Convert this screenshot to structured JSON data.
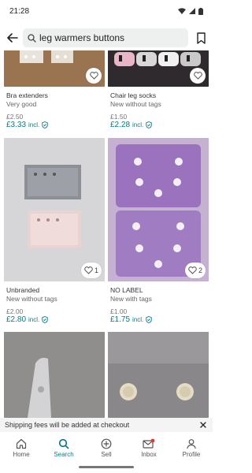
{
  "status": {
    "time": "21:28"
  },
  "search": {
    "query": "leg warmers buttons",
    "placeholder": "Search for items"
  },
  "products": [
    {
      "brand": "Bra extenders",
      "condition": "Very good",
      "price": "£2.50",
      "price_incl": "£3.33",
      "incl_label": "incl.",
      "likes": ""
    },
    {
      "brand": "Chair leg socks",
      "condition": "New without tags",
      "price": "£1.50",
      "price_incl": "£2.28",
      "incl_label": "incl.",
      "likes": ""
    },
    {
      "brand": "Unbranded",
      "condition": "New without tags",
      "price": "£2.00",
      "price_incl": "£2.80",
      "incl_label": "incl.",
      "likes": "1"
    },
    {
      "brand": "NO LABEL",
      "condition": "New with tags",
      "price": "£1.00",
      "price_incl": "£1.75",
      "incl_label": "incl.",
      "likes": "2"
    }
  ],
  "banner": {
    "text": "Shipping fees will be added at checkout"
  },
  "nav": {
    "items": [
      {
        "label": "Home",
        "icon": "home-icon"
      },
      {
        "label": "Search",
        "icon": "search-icon"
      },
      {
        "label": "Sell",
        "icon": "plus-circle-icon"
      },
      {
        "label": "Inbox",
        "icon": "mail-icon"
      },
      {
        "label": "Profile",
        "icon": "person-icon"
      }
    ],
    "active": "Search"
  },
  "colors": {
    "accent": "#0b7a85",
    "notification_dot": "#e0392b"
  }
}
